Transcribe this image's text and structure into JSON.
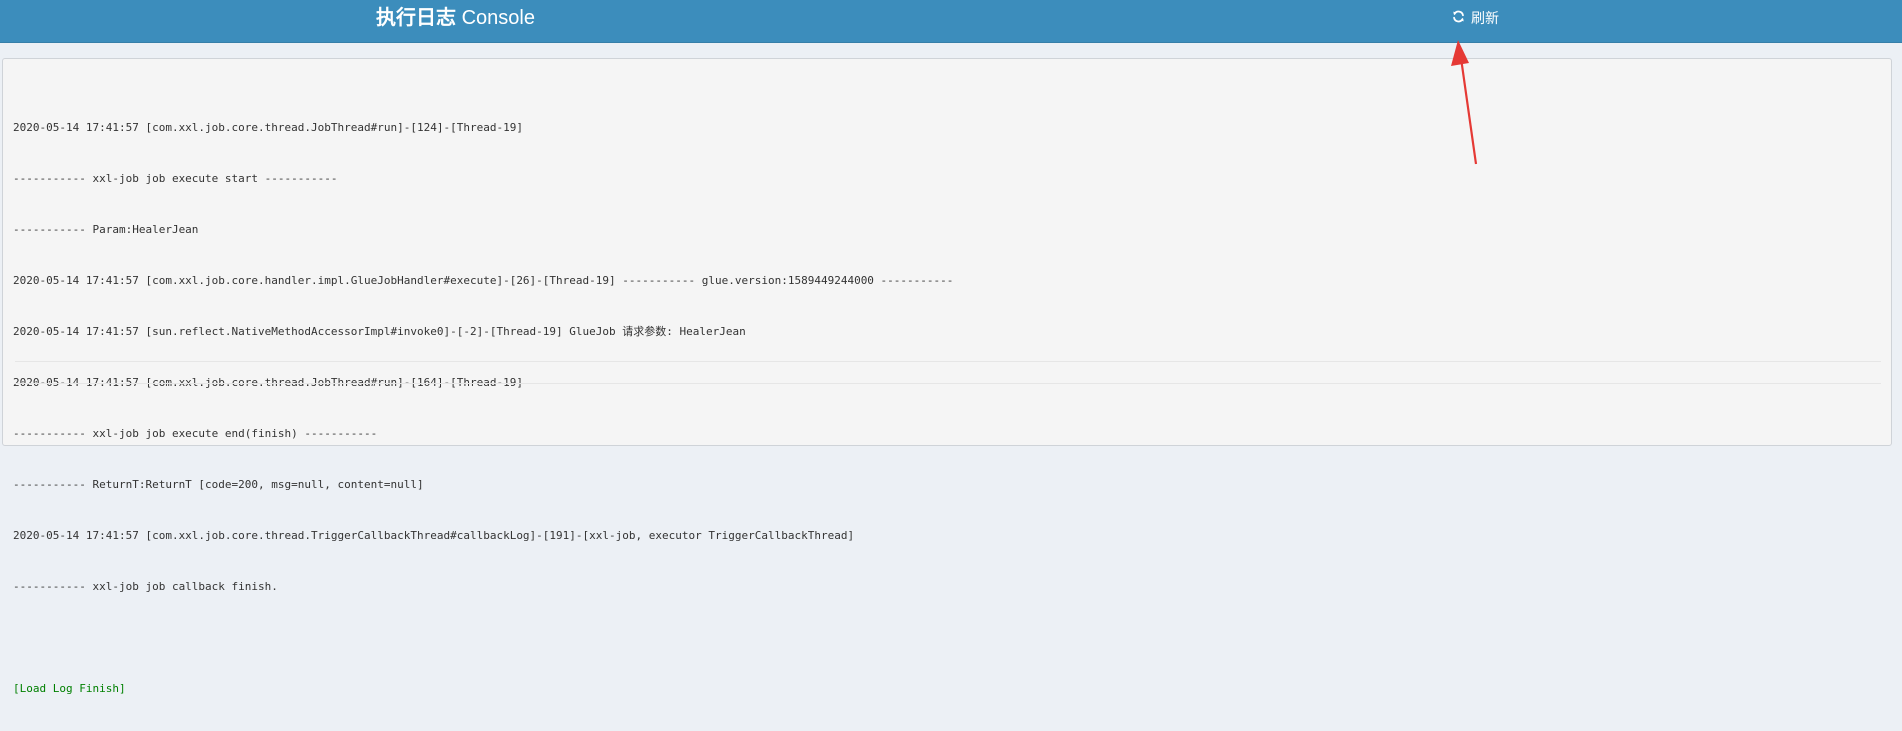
{
  "header": {
    "title_cn": "执行日志",
    "title_en": "Console",
    "refresh_label": "刷新",
    "refresh_icon": "refresh-icon",
    "background_color": "#3c8dbc"
  },
  "console": {
    "lines": [
      "2020-05-14 17:41:57 [com.xxl.job.core.thread.JobThread#run]-[124]-[Thread-19]",
      "----------- xxl-job job execute start -----------",
      "----------- Param:HealerJean",
      "2020-05-14 17:41:57 [com.xxl.job.core.handler.impl.GlueJobHandler#execute]-[26]-[Thread-19] ----------- glue.version:1589449244000 -----------",
      "2020-05-14 17:41:57 [sun.reflect.NativeMethodAccessorImpl#invoke0]-[-2]-[Thread-19] GlueJob 请求参数: HealerJean",
      "2020-05-14 17:41:57 [com.xxl.job.core.thread.JobThread#run]-[164]-[Thread-19]",
      "----------- xxl-job job execute end(finish) -----------",
      "----------- ReturnT:ReturnT [code=200, msg=null, content=null]",
      "2020-05-14 17:41:57 [com.xxl.job.core.thread.TriggerCallbackThread#callbackLog]-[191]-[xxl-job, executor TriggerCallbackThread]",
      "----------- xxl-job job callback finish."
    ],
    "finish_text": "[Load Log Finish]",
    "finish_color": "#008000"
  },
  "annotation": {
    "arrow_color": "#e53935"
  }
}
